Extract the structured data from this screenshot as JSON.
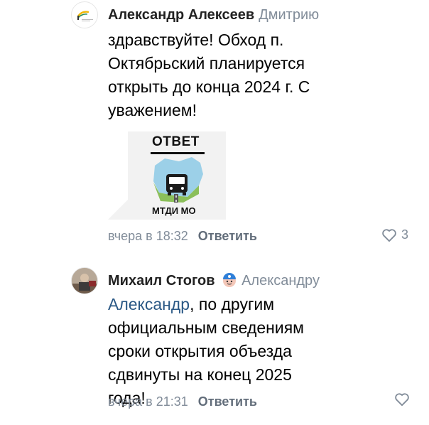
{
  "comments": [
    {
      "author": "Александр Алексеев",
      "reply_to": "Дмитрию",
      "text": "здравствуйте! Обход п. Октябрьский планируется открыть до конца 2024 г. С уважением!",
      "sticker": {
        "title": "ОТВЕТ",
        "caption": "МТДИ МО"
      },
      "time": "вчера в 18:32",
      "reply_label": "Ответить",
      "likes": "3"
    },
    {
      "author": "Михаил Стогов",
      "reply_to": "Александру",
      "mention": "Александр",
      "text": ", по другим официальным сведениям сроки открытия объезда сдвинуты на конец 2025 года!",
      "time": "вчера в 21:31",
      "reply_label": "Ответить"
    }
  ],
  "colors": {
    "accent": "#2a5885",
    "muted": "#818c99",
    "sticker_bg": "#f2f2f2"
  },
  "icons": [
    "organization-logo-icon",
    "heart-icon",
    "emoji-badge-icon",
    "user-avatar"
  ]
}
